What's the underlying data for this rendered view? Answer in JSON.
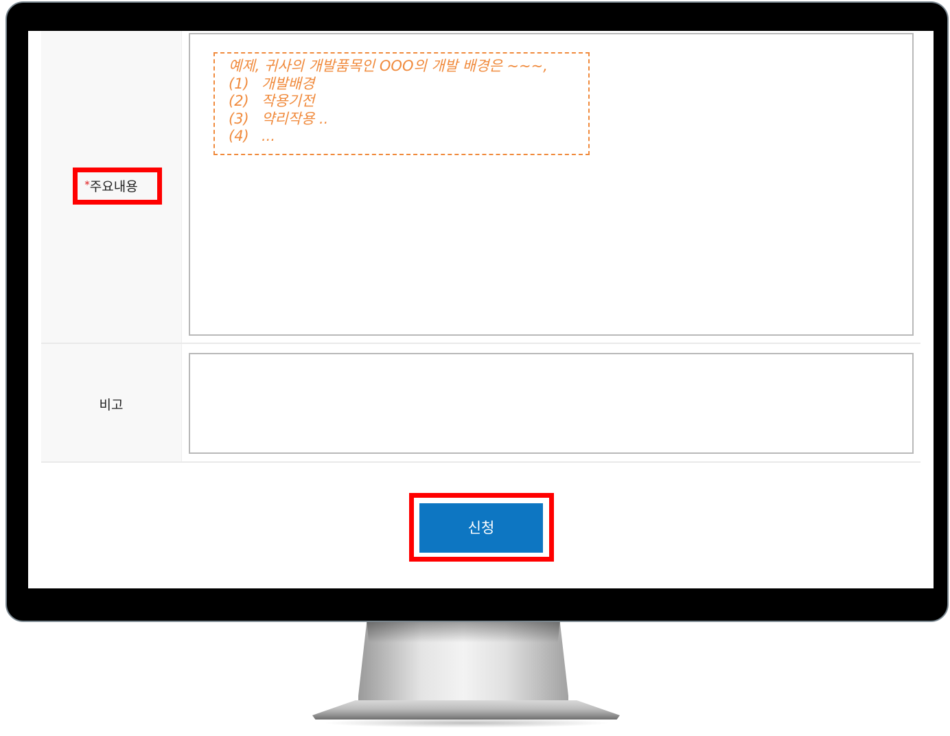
{
  "form": {
    "main_content": {
      "required_mark": "*",
      "label": "주요내용",
      "placeholder_lines": [
        {
          "num": "",
          "text": "예제, 귀사의 개발품목인 OOO의 개발 배경은 ~~~,"
        },
        {
          "num": "(1)",
          "text": "개발배경"
        },
        {
          "num": "(2)",
          "text": "작용기전"
        },
        {
          "num": "(3)",
          "text": "약리작용 .."
        },
        {
          "num": "(4)",
          "text": "..."
        }
      ]
    },
    "remarks": {
      "label": "비고"
    },
    "submit_label": "신청"
  },
  "colors": {
    "highlight": "#ff0000",
    "button": "#0d76c2",
    "placeholder": "#f08a3c",
    "required": "#e0191b"
  }
}
